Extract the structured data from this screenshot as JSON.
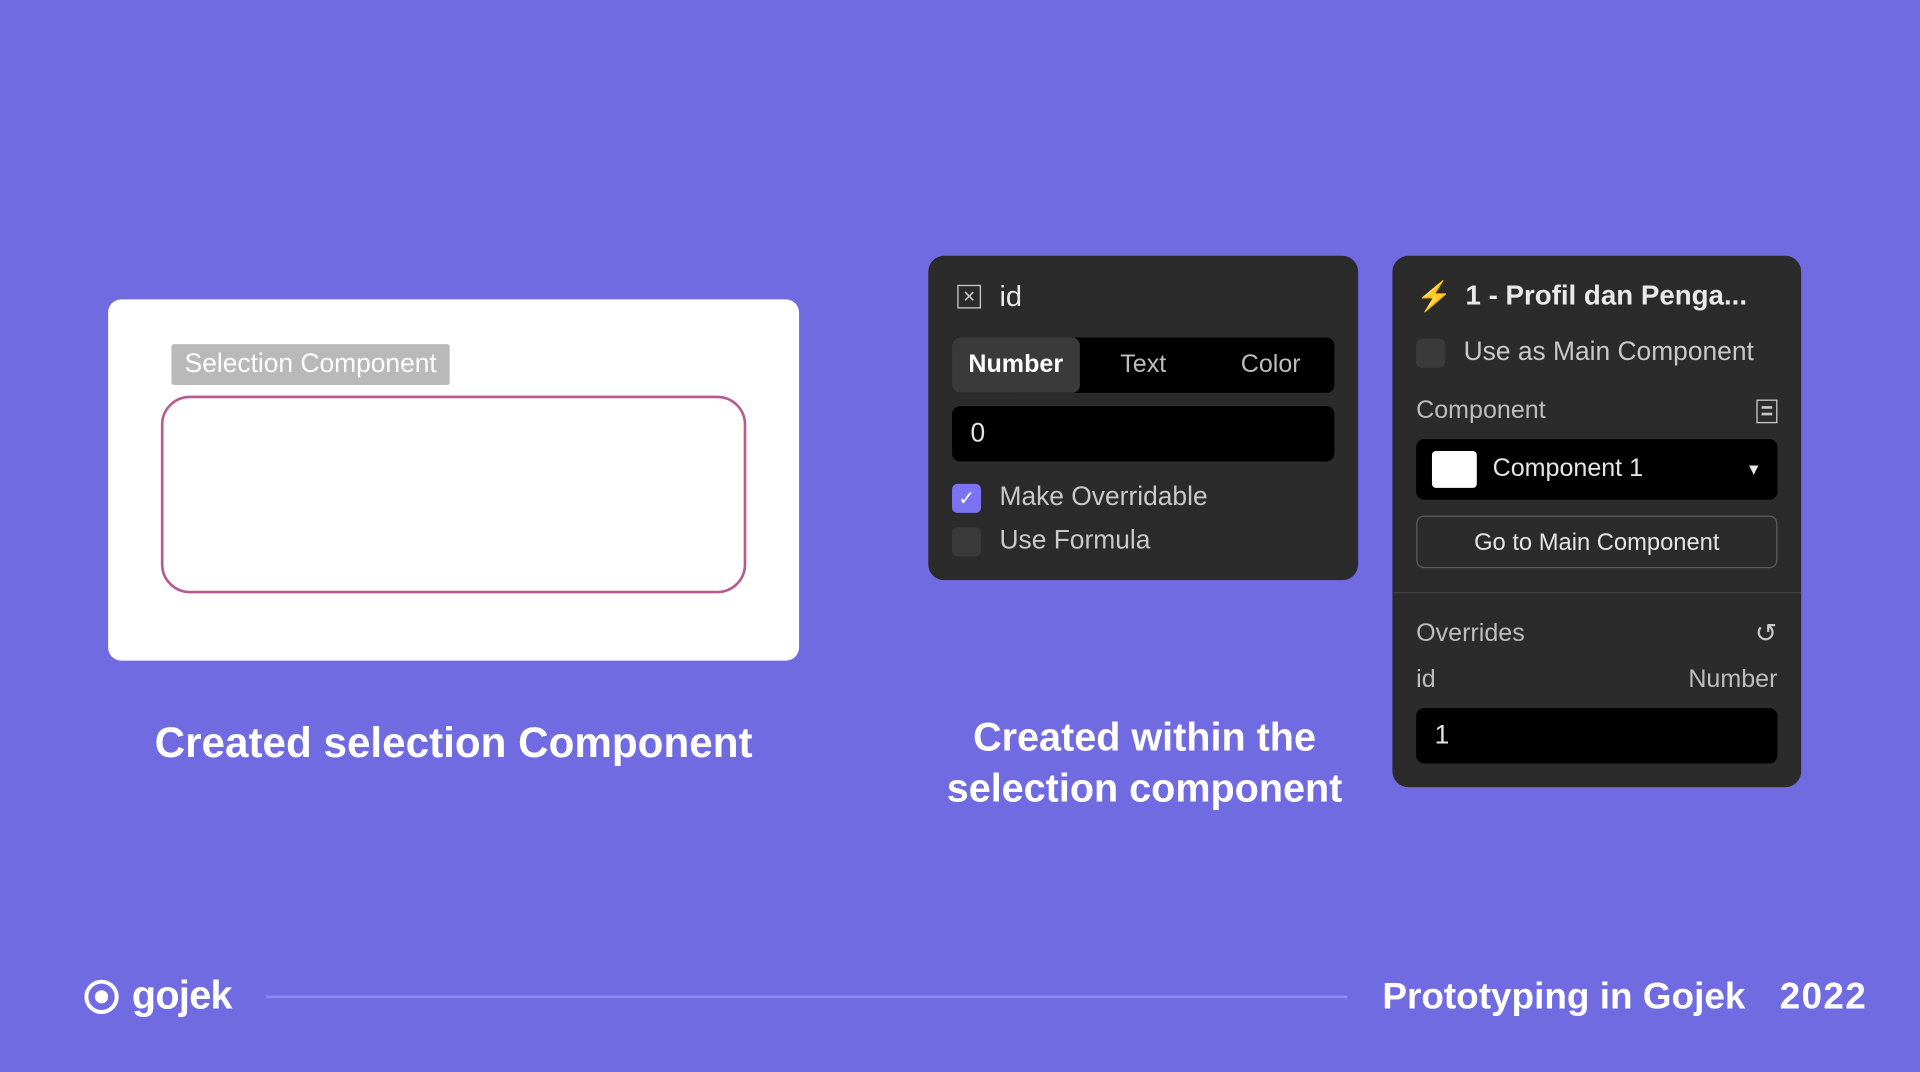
{
  "leftCard": {
    "badge": "Selection Component"
  },
  "captions": {
    "left": "Created selection Component",
    "middle": "Created within the selection component"
  },
  "idPanel": {
    "title": "id",
    "tabs": {
      "number": "Number",
      "text": "Text",
      "color": "Color"
    },
    "value": "0",
    "overridable": "Make Overridable",
    "formula": "Use Formula"
  },
  "compPanel": {
    "title": "1 - Profil dan Penga...",
    "useMain": "Use as Main Component",
    "componentLabel": "Component",
    "componentName": "Component 1",
    "goBtn": "Go to Main Component",
    "overridesLabel": "Overrides",
    "overrideKey": "id",
    "overrideType": "Number",
    "overrideValue": "1"
  },
  "footer": {
    "brand": "gojek",
    "title": "Prototyping in Gojek",
    "year": "2022"
  }
}
